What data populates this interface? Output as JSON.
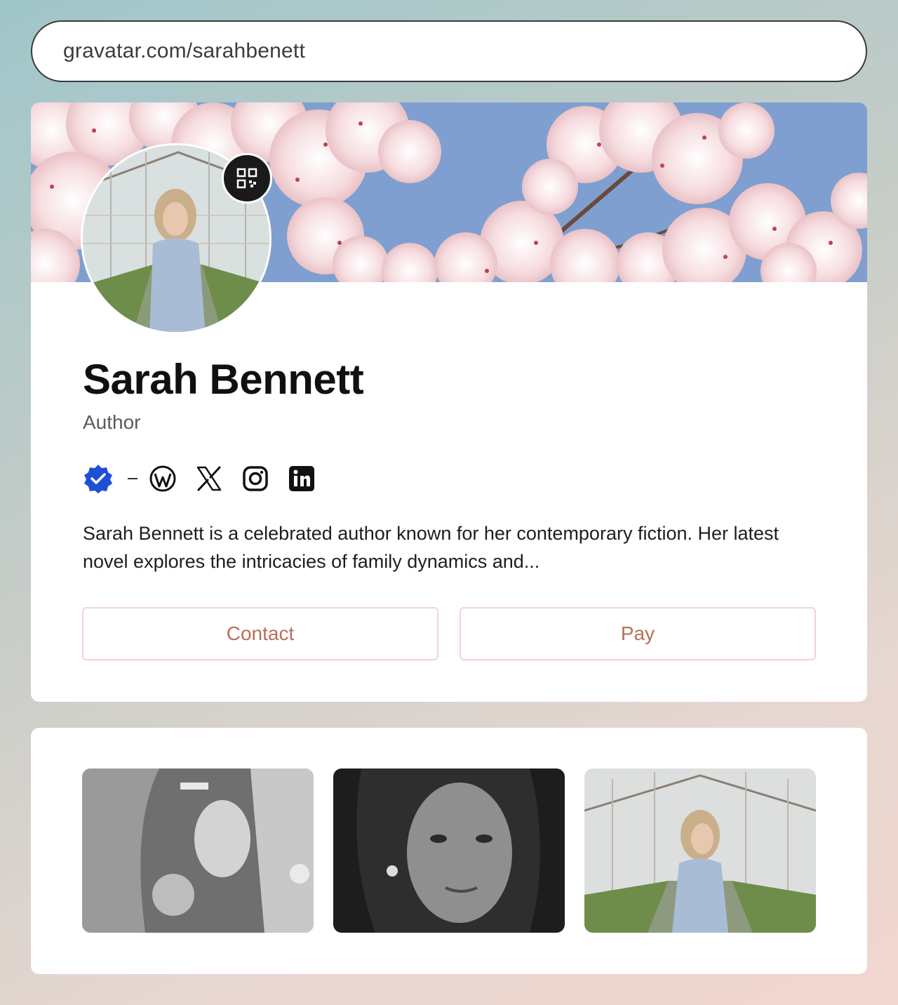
{
  "url": "gravatar.com/sarahbenett",
  "profile": {
    "name": "Sarah Bennett",
    "job_title": "Author",
    "bio": "Sarah Bennett is a celebrated author known for her contemporary fiction. Her latest novel explores the intricacies of family dynamics and...",
    "verified_icon": "verified-badge-icon",
    "socials": [
      {
        "icon": "wordpress-icon"
      },
      {
        "icon": "x-icon"
      },
      {
        "icon": "instagram-icon"
      },
      {
        "icon": "linkedin-icon"
      }
    ]
  },
  "actions": {
    "contact_label": "Contact",
    "pay_label": "Pay"
  },
  "colors": {
    "accent": "#b5705a",
    "button_border": "#efd6cf",
    "verified": "#1f4fd6",
    "sky": "#7f9fd0"
  },
  "gallery": [
    {
      "description": "black-and-white photo"
    },
    {
      "description": "black-and-white portrait"
    },
    {
      "description": "color photo in greenhouse"
    }
  ]
}
